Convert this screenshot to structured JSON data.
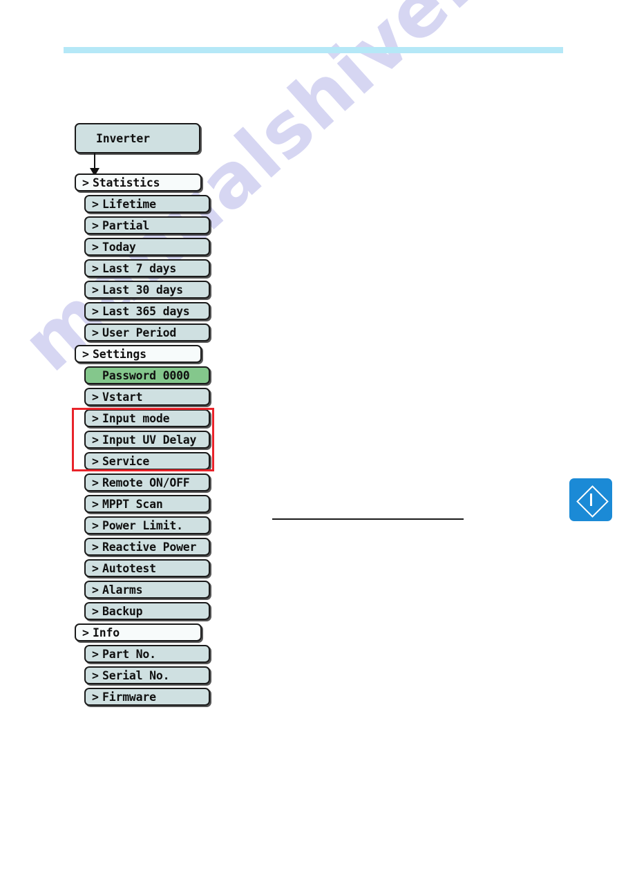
{
  "page": {
    "watermark_text": "manualshive.com",
    "top_bar_color": "#b5e8f7",
    "badge_color": "#1b8ad6",
    "highlight_color": "#e8232a",
    "node_fill": "#cfe0e1",
    "node_fill_level1": "#f7fbfb",
    "node_fill_highlighted": "#84c78c"
  },
  "side_badge": {
    "icon": "diamond-info-icon"
  },
  "menu_tree": {
    "root": {
      "label": "Inverter",
      "level": 0,
      "chevron": ""
    },
    "items": [
      {
        "label": "Statistics",
        "level": 1,
        "chevron": ">",
        "fill": "level1"
      },
      {
        "label": "Lifetime",
        "level": 2,
        "chevron": ">",
        "fill": "normal"
      },
      {
        "label": "Partial",
        "level": 2,
        "chevron": ">",
        "fill": "normal"
      },
      {
        "label": "Today",
        "level": 2,
        "chevron": ">",
        "fill": "normal"
      },
      {
        "label": "Last 7 days",
        "level": 2,
        "chevron": ">",
        "fill": "normal"
      },
      {
        "label": "Last 30 days",
        "level": 2,
        "chevron": ">",
        "fill": "normal"
      },
      {
        "label": "Last 365 days",
        "level": 2,
        "chevron": ">",
        "fill": "normal"
      },
      {
        "label": "User Period",
        "level": 2,
        "chevron": ">",
        "fill": "normal"
      },
      {
        "label": "Settings",
        "level": 1,
        "chevron": ">",
        "fill": "level1"
      },
      {
        "label": "Password 0000",
        "level": 2,
        "chevron": "",
        "fill": "green"
      },
      {
        "label": "Vstart",
        "level": 2,
        "chevron": ">",
        "fill": "normal"
      },
      {
        "label": "Input mode",
        "level": 2,
        "chevron": ">",
        "fill": "normal"
      },
      {
        "label": "Input UV Delay",
        "level": 2,
        "chevron": ">",
        "fill": "normal"
      },
      {
        "label": "Service",
        "level": 2,
        "chevron": ">",
        "fill": "normal"
      },
      {
        "label": "Remote ON/OFF",
        "level": 2,
        "chevron": ">",
        "fill": "normal"
      },
      {
        "label": "MPPT Scan",
        "level": 2,
        "chevron": ">",
        "fill": "normal"
      },
      {
        "label": "Power Limit.",
        "level": 2,
        "chevron": ">",
        "fill": "normal"
      },
      {
        "label": "Reactive Power",
        "level": 2,
        "chevron": ">",
        "fill": "normal"
      },
      {
        "label": "Autotest",
        "level": 2,
        "chevron": ">",
        "fill": "normal"
      },
      {
        "label": "Alarms",
        "level": 2,
        "chevron": ">",
        "fill": "normal"
      },
      {
        "label": "Backup",
        "level": 2,
        "chevron": ">",
        "fill": "normal"
      },
      {
        "label": "Info",
        "level": 1,
        "chevron": ">",
        "fill": "level1"
      },
      {
        "label": "Part No.",
        "level": 2,
        "chevron": ">",
        "fill": "normal"
      },
      {
        "label": "Serial No.",
        "level": 2,
        "chevron": ">",
        "fill": "normal"
      },
      {
        "label": "Firmware",
        "level": 2,
        "chevron": ">",
        "fill": "normal"
      }
    ],
    "highlighted_group": [
      "Input mode",
      "Input UV Delay",
      "Service"
    ]
  }
}
